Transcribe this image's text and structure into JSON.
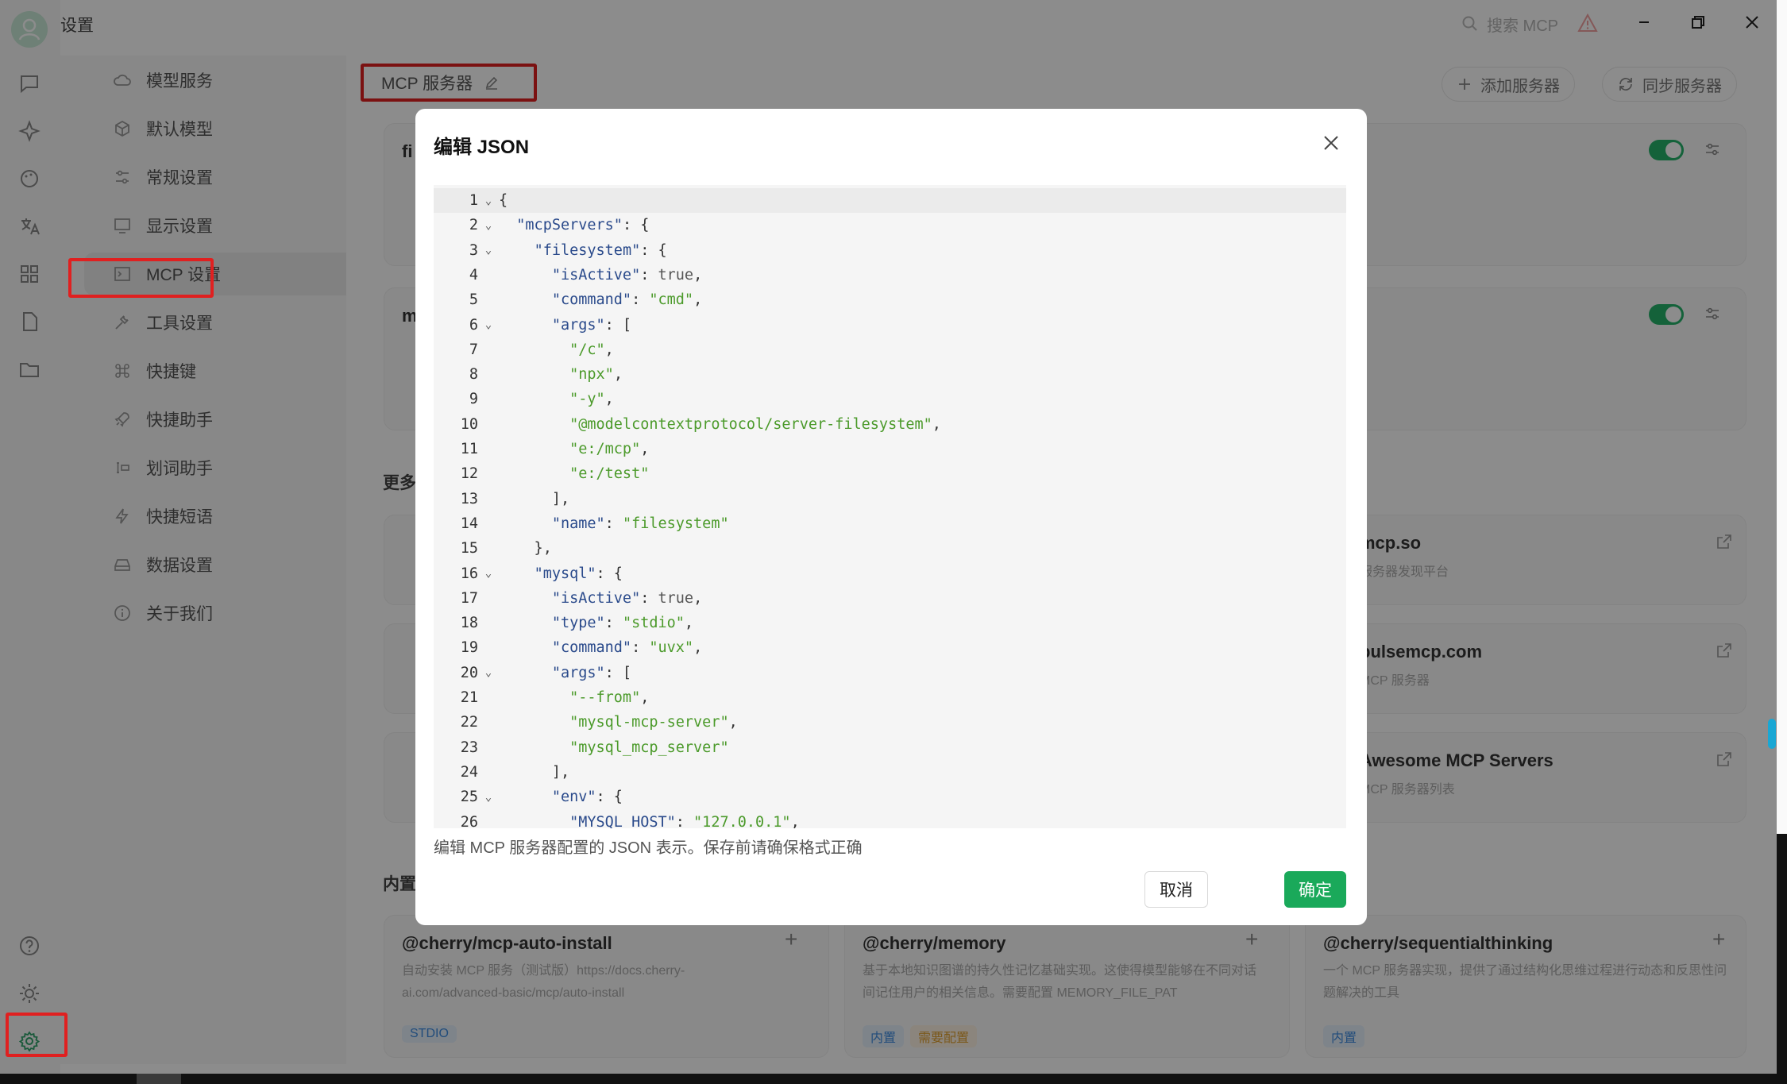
{
  "app": {
    "title": "设置"
  },
  "search": {
    "placeholder": "搜索 MCP"
  },
  "nav": {
    "items": [
      {
        "label": "模型服务",
        "icon": "cloud-icon"
      },
      {
        "label": "默认模型",
        "icon": "cube-icon"
      },
      {
        "label": "常规设置",
        "icon": "sliders-icon"
      },
      {
        "label": "显示设置",
        "icon": "monitor-icon"
      },
      {
        "label": "MCP 设置",
        "icon": "terminal-icon"
      },
      {
        "label": "工具设置",
        "icon": "tools-icon"
      },
      {
        "label": "快捷键",
        "icon": "command-icon"
      },
      {
        "label": "快捷助手",
        "icon": "rocket-icon"
      },
      {
        "label": "划词助手",
        "icon": "text-select-icon"
      },
      {
        "label": "快捷短语",
        "icon": "zap-icon"
      },
      {
        "label": "数据设置",
        "icon": "hard-drive-icon"
      },
      {
        "label": "关于我们",
        "icon": "info-icon"
      }
    ]
  },
  "page": {
    "title": "MCP 服务器",
    "add_button": "添加服务器",
    "sync_button": "同步服务器",
    "servers": [
      {
        "title_partial": "fi"
      },
      {
        "title_partial": "m"
      }
    ],
    "more_section": "更多",
    "builtin_section": "内置",
    "discovery": [
      {
        "title": "mcp.so",
        "desc": "服务器发现平台"
      },
      {
        "title": "pulsemcp.com",
        "desc": "MCP 服务器"
      },
      {
        "title": "Awesome MCP Servers",
        "desc": "MCP 服务器列表"
      }
    ],
    "builtin_cards": [
      {
        "title": "@cherry/mcp-auto-install",
        "desc": "自动安装 MCP 服务（测试版）https://docs.cherry-ai.com/advanced-basic/mcp/auto-install",
        "tags": [
          "STDIO"
        ]
      },
      {
        "title": "@cherry/memory",
        "desc": "基于本地知识图谱的持久性记忆基础实现。这使得模型能够在不同对话间记住用户的相关信息。需要配置 MEMORY_FILE_PAT",
        "tags": [
          "内置",
          "需要配置"
        ]
      },
      {
        "title": "@cherry/sequentialthinking",
        "desc": "一个 MCP 服务器实现，提供了通过结构化思维过程进行动态和反思性问题解决的工具",
        "tags": [
          "内置"
        ]
      }
    ]
  },
  "modal": {
    "title": "编辑 JSON",
    "hint": "编辑 MCP 服务器配置的 JSON 表示。保存前请确保格式正确",
    "cancel": "取消",
    "ok": "确定",
    "lines": [
      {
        "n": "1",
        "fold": true,
        "text": "{"
      },
      {
        "n": "2",
        "fold": true,
        "text": "  \"mcpServers\": {"
      },
      {
        "n": "3",
        "fold": true,
        "text": "    \"filesystem\": {"
      },
      {
        "n": "4",
        "fold": false,
        "text": "      \"isActive\": true,"
      },
      {
        "n": "5",
        "fold": false,
        "text": "      \"command\": \"cmd\","
      },
      {
        "n": "6",
        "fold": true,
        "text": "      \"args\": ["
      },
      {
        "n": "7",
        "fold": false,
        "text": "        \"/c\","
      },
      {
        "n": "8",
        "fold": false,
        "text": "        \"npx\","
      },
      {
        "n": "9",
        "fold": false,
        "text": "        \"-y\","
      },
      {
        "n": "10",
        "fold": false,
        "text": "        \"@modelcontextprotocol/server-filesystem\","
      },
      {
        "n": "11",
        "fold": false,
        "text": "        \"e:/mcp\","
      },
      {
        "n": "12",
        "fold": false,
        "text": "        \"e:/test\""
      },
      {
        "n": "13",
        "fold": false,
        "text": "      ],"
      },
      {
        "n": "14",
        "fold": false,
        "text": "      \"name\": \"filesystem\""
      },
      {
        "n": "15",
        "fold": false,
        "text": "    },"
      },
      {
        "n": "16",
        "fold": true,
        "text": "    \"mysql\": {"
      },
      {
        "n": "17",
        "fold": false,
        "text": "      \"isActive\": true,"
      },
      {
        "n": "18",
        "fold": false,
        "text": "      \"type\": \"stdio\","
      },
      {
        "n": "19",
        "fold": false,
        "text": "      \"command\": \"uvx\","
      },
      {
        "n": "20",
        "fold": true,
        "text": "      \"args\": ["
      },
      {
        "n": "21",
        "fold": false,
        "text": "        \"--from\","
      },
      {
        "n": "22",
        "fold": false,
        "text": "        \"mysql-mcp-server\","
      },
      {
        "n": "23",
        "fold": false,
        "text": "        \"mysql_mcp_server\""
      },
      {
        "n": "24",
        "fold": false,
        "text": "      ],"
      },
      {
        "n": "25",
        "fold": true,
        "text": "      \"env\": {"
      },
      {
        "n": "26",
        "fold": false,
        "text": "        \"MYSQL_HOST\": \"127.0.0.1\","
      }
    ]
  },
  "colors": {
    "accent": "#1aa95a",
    "highlight": "#e02020"
  }
}
